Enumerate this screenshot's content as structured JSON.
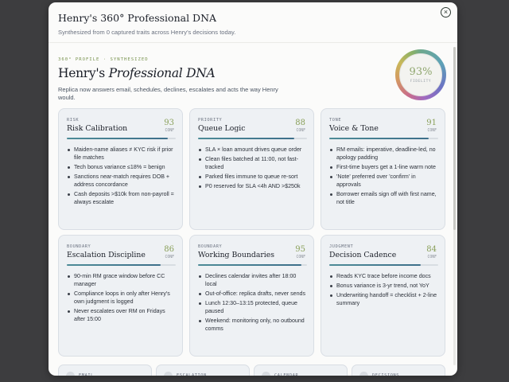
{
  "modal": {
    "title": "Henry's 360° Professional DNA",
    "subtitle": "Synthesized from 0 captured traits across Henry's decisions today.",
    "close_icon": "×"
  },
  "hero": {
    "eyebrow": "360° PROFILE · SYNTHESIZED",
    "title_plain": "Henry's ",
    "title_italic": "Professional DNA",
    "description": "Replica now answers email, schedules, declines, escalates and acts the way Henry would."
  },
  "fidelity": {
    "value": "93%",
    "label": "FIDELITY",
    "percent": 93
  },
  "cards": [
    {
      "category": "RISK",
      "name": "Risk Calibration",
      "score": "93",
      "conf": "CONF",
      "percent": 93,
      "items": [
        "Maiden-name aliases ≠ KYC risk if prior file matches",
        "Tech bonus variance ≤18% = benign",
        "Sanctions near-match requires DOB + address concordance",
        "Cash deposits >$10k from non-payroll = always escalate"
      ]
    },
    {
      "category": "PRIORITY",
      "name": "Queue Logic",
      "score": "88",
      "conf": "CONF",
      "percent": 88,
      "items": [
        "SLA × loan amount drives queue order",
        "Clean files batched at 11:00, not fast-tracked",
        "Parked files immune to queue re-sort",
        "P0 reserved for SLA <4h AND >$250k"
      ]
    },
    {
      "category": "TONE",
      "name": "Voice & Tone",
      "score": "91",
      "conf": "CONF",
      "percent": 91,
      "items": [
        "RM emails: imperative, deadline-led, no apology padding",
        "First-time buyers get a 1-line warm note",
        "'Note' preferred over 'confirm' in approvals",
        "Borrower emails sign off with first name, not title"
      ]
    },
    {
      "category": "BOUNDARY",
      "name": "Escalation Discipline",
      "score": "86",
      "conf": "CONF",
      "percent": 86,
      "items": [
        "90-min RM grace window before CC manager",
        "Compliance loops in only after Henry's own judgment is logged",
        "Never escalates over RM on Fridays after 15:00"
      ]
    },
    {
      "category": "BOUNDARY",
      "name": "Working Boundaries",
      "score": "95",
      "conf": "CONF",
      "percent": 95,
      "items": [
        "Declines calendar invites after 18:00 local",
        "Out-of-office: replica drafts, never sends",
        "Lunch 12:30–13:15 protected, queue paused",
        "Weekend: monitoring only, no outbound comms"
      ]
    },
    {
      "category": "JUDGMENT",
      "name": "Decision Cadence",
      "score": "84",
      "conf": "CONF",
      "percent": 84,
      "items": [
        "Reads KYC trace before income docs",
        "Bonus variance is 3-yr trend, not YoY",
        "Underwriting handoff = checklist + 2-line summary"
      ]
    }
  ],
  "mini_cards": [
    {
      "label": "EMAIL"
    },
    {
      "label": "ESCALATION"
    },
    {
      "label": "CALENDAR"
    },
    {
      "label": "DECISIONS"
    }
  ]
}
